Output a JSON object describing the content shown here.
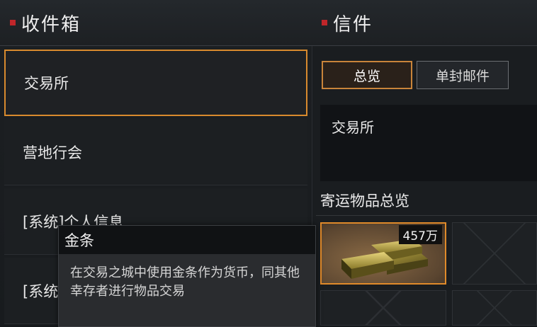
{
  "inbox": {
    "title": "收件箱",
    "items": [
      {
        "label": "交易所"
      },
      {
        "label": "营地行会"
      },
      {
        "label": "[系统]个人信息"
      },
      {
        "label": "[系统]"
      }
    ]
  },
  "letter": {
    "title": "信件",
    "tabs": [
      {
        "label": "总览"
      },
      {
        "label": "单封邮件"
      }
    ],
    "sender": "交易所",
    "section_title": "寄运物品总览",
    "items": [
      {
        "name": "金条",
        "quantity": "457万",
        "icon": "gold-bars-icon"
      }
    ]
  },
  "tooltip": {
    "title": "金条",
    "description": "在交易之城中使用金条作为货币，同其他幸存者进行物品交易"
  },
  "colors": {
    "accent": "#d88a2e",
    "header_mark": "#c0262a"
  }
}
